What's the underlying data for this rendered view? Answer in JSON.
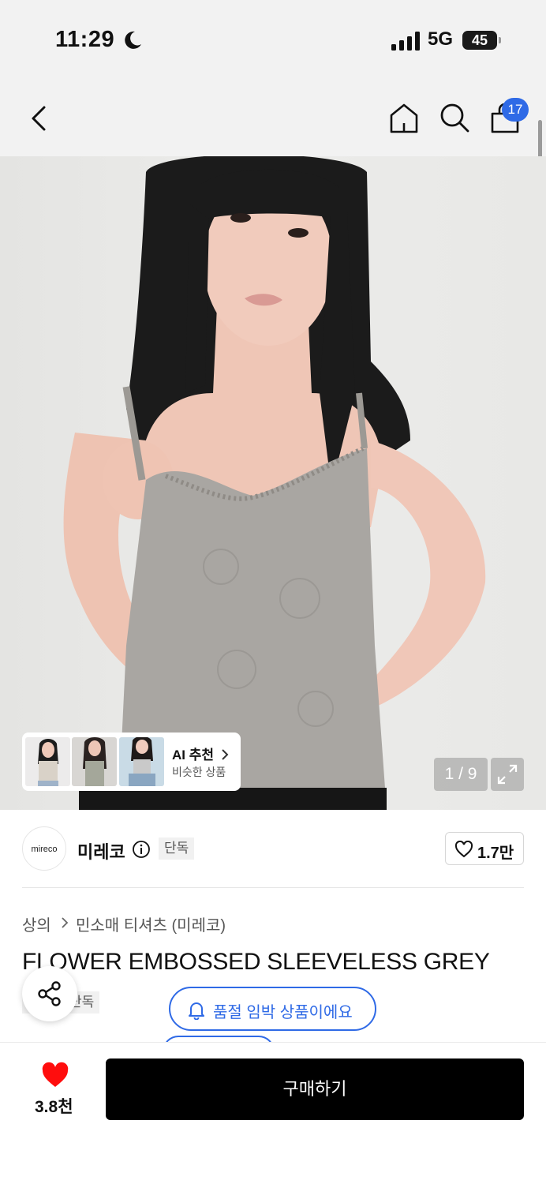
{
  "status_bar": {
    "time": "11:29",
    "network": "5G",
    "battery": "45"
  },
  "header": {
    "cart_count": "17"
  },
  "gallery": {
    "ai_title": "AI 추천",
    "ai_subtitle": "비슷한 상품",
    "counter": "1 / 9"
  },
  "brand": {
    "logo_text": "mireco",
    "name": "미레코",
    "tag": "단독",
    "like_count": "1.7만"
  },
  "product": {
    "breadcrumb_1": "상의",
    "breadcrumb_2": "민소매 티셔츠 (미레코)",
    "title": "FLOWER EMBOSSED SLEEVELESS GREY",
    "tag": "단독"
  },
  "alert": {
    "text": "품절 임박 상품이에요"
  },
  "bottom": {
    "wish_count": "3.8천",
    "buy_label": "구매하기"
  },
  "colors": {
    "accent": "#2f6ae6",
    "heart": "#ff0d0d",
    "buy_button": "#000000"
  },
  "icons": [
    "back-icon",
    "home-icon",
    "search-icon",
    "shopping-bag-icon",
    "info-icon",
    "heart-outline-icon",
    "share-icon",
    "bell-icon",
    "heart-filled-icon",
    "expand-icon",
    "chevron-right-icon"
  ]
}
